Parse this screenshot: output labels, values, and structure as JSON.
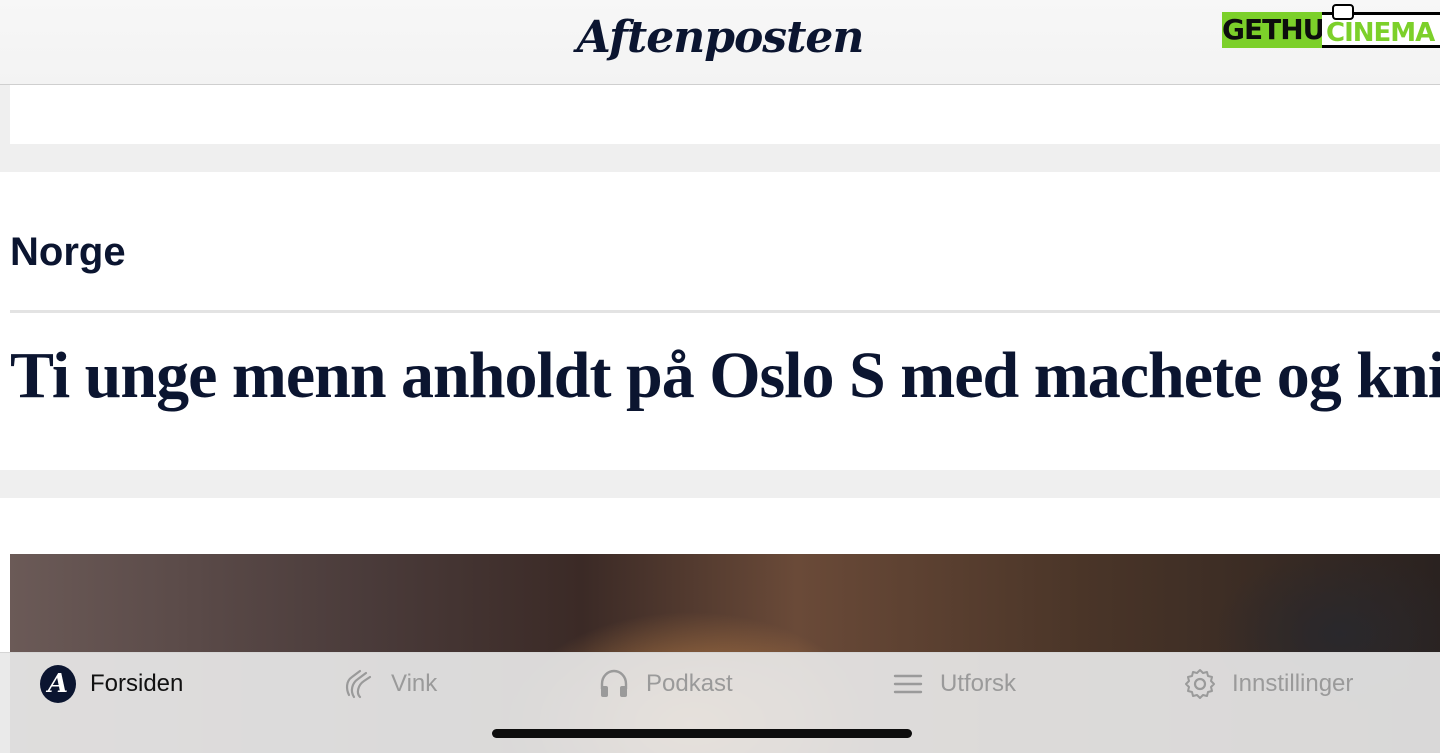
{
  "header": {
    "logo_text": "Aftenposten",
    "watermark": {
      "left_text": "GETHU",
      "right_text": "CINEMA"
    }
  },
  "section": {
    "title": "Norge",
    "headline": "Ti unge menn anholdt på Oslo S med machete og kniv"
  },
  "tabbar": {
    "tabs": [
      {
        "label": "Forsiden",
        "icon": "aftenposten-a-icon",
        "active": true
      },
      {
        "label": "Vink",
        "icon": "wave-hand-icon",
        "active": false
      },
      {
        "label": "Podkast",
        "icon": "headphones-icon",
        "active": false
      },
      {
        "label": "Utforsk",
        "icon": "menu-lines-icon",
        "active": false
      },
      {
        "label": "Innstillinger",
        "icon": "gear-icon",
        "active": false
      }
    ],
    "avatar_letter": "A"
  },
  "colors": {
    "navy": "#0b1530",
    "watermark_green": "#7cd02a",
    "tab_inactive": "#9a9a9a"
  }
}
